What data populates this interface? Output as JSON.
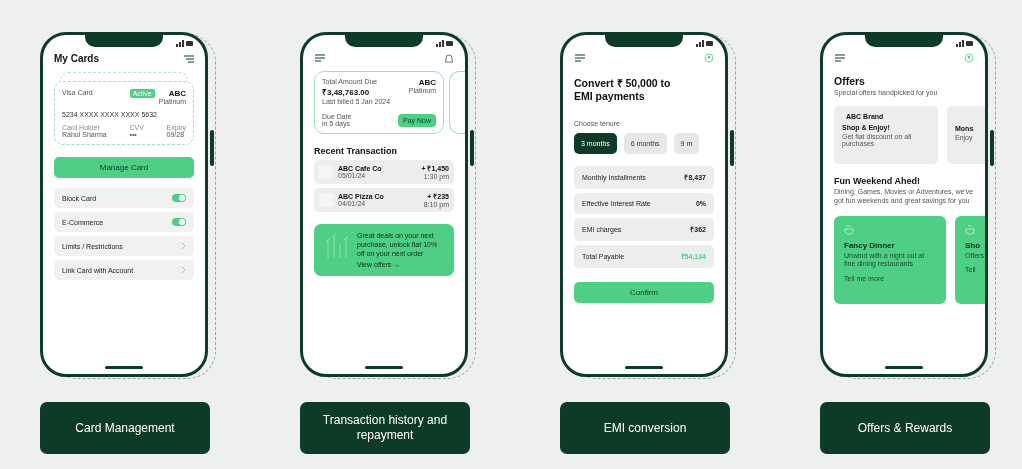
{
  "panels": [
    {
      "kind": "cards",
      "caption": "Card Management",
      "title": "My Cards",
      "card": {
        "name": "Visa Card",
        "tag": "Active",
        "bank": "ABC",
        "tier": "Platinum",
        "number": "5234 XXXX XXXX XXXX 5632",
        "holder_label": "Card Holder",
        "holder": "Rahul Sharma",
        "cvv_label": "CVV",
        "cvv": "•••",
        "expiry_label": "Expiry",
        "expiry": "09/28"
      },
      "action": "Manage Card",
      "settings": [
        {
          "kind": "toggle",
          "label": "Block Card",
          "on": true
        },
        {
          "kind": "toggle",
          "label": "E-Commerce",
          "on": true
        },
        {
          "kind": "link",
          "label": "Limits / Restrictions"
        },
        {
          "kind": "link",
          "label": "Link Card with Account"
        }
      ]
    },
    {
      "kind": "transactions",
      "caption": "Transaction history and repayment",
      "bill": {
        "label": "Total Amount Due",
        "amount": "₹3,48,763.00",
        "note": "Last billed 5 Jan 2024",
        "bank": "ABC",
        "tier": "Platinum",
        "due_label": "Due Date",
        "due": "in 5 days",
        "button": "Pay Now"
      },
      "section": "Recent Transaction",
      "transactions": [
        {
          "name": "ABC Cafe Co",
          "date": "05/01/24",
          "amount": "+ ₹1,450",
          "time": "1:30 pm"
        },
        {
          "name": "ABC Pizza Co",
          "date": "04/01/24",
          "amount": "+ ₹235",
          "time": "8:10 pm"
        }
      ],
      "promo": {
        "text": "Great deals on your next purchase, unlock flat 10% off on your next order",
        "link": "View offers →"
      }
    },
    {
      "kind": "emi",
      "caption": "EMI conversion",
      "title": "Convert ₹ 50,000 to EMI payments",
      "tenure_label": "Choose tenure",
      "tenures": [
        {
          "label": "3 months",
          "selected": true
        },
        {
          "label": "6 months",
          "selected": false
        },
        {
          "label": "9 m",
          "selected": false
        }
      ],
      "details": [
        {
          "label": "Monthly Installments",
          "value": "₹8,437",
          "highlight": false
        },
        {
          "label": "Effective Interest Rate",
          "value": "0%",
          "highlight": false
        },
        {
          "label": "EMI charges",
          "value": "₹362",
          "highlight": false
        },
        {
          "label": "Total Payable",
          "value": "₹54,134",
          "highlight": true
        }
      ],
      "button": "Confirm"
    },
    {
      "kind": "offers",
      "caption": "Offers & Rewards",
      "title": "Offers",
      "subtitle": "Special offers handpicked for you",
      "offers": [
        {
          "brand": "ABC Brand",
          "title": "Shop & Enjoy!",
          "text": "Get flat discount on all purchases"
        },
        {
          "title": "Mons",
          "text": "Enjoy"
        }
      ],
      "section": "Fun Weekend Ahed!",
      "section_text": "Dining, Games, Movies or Adventures, we've got fun weekends and great savings for you",
      "events": [
        {
          "title": "Fancy Dinner",
          "text": "Unwind with a night out at fine dining restaurants",
          "link": "Tell me more"
        },
        {
          "title": "Sho",
          "text": "Offers",
          "link": "Tell"
        }
      ]
    }
  ]
}
